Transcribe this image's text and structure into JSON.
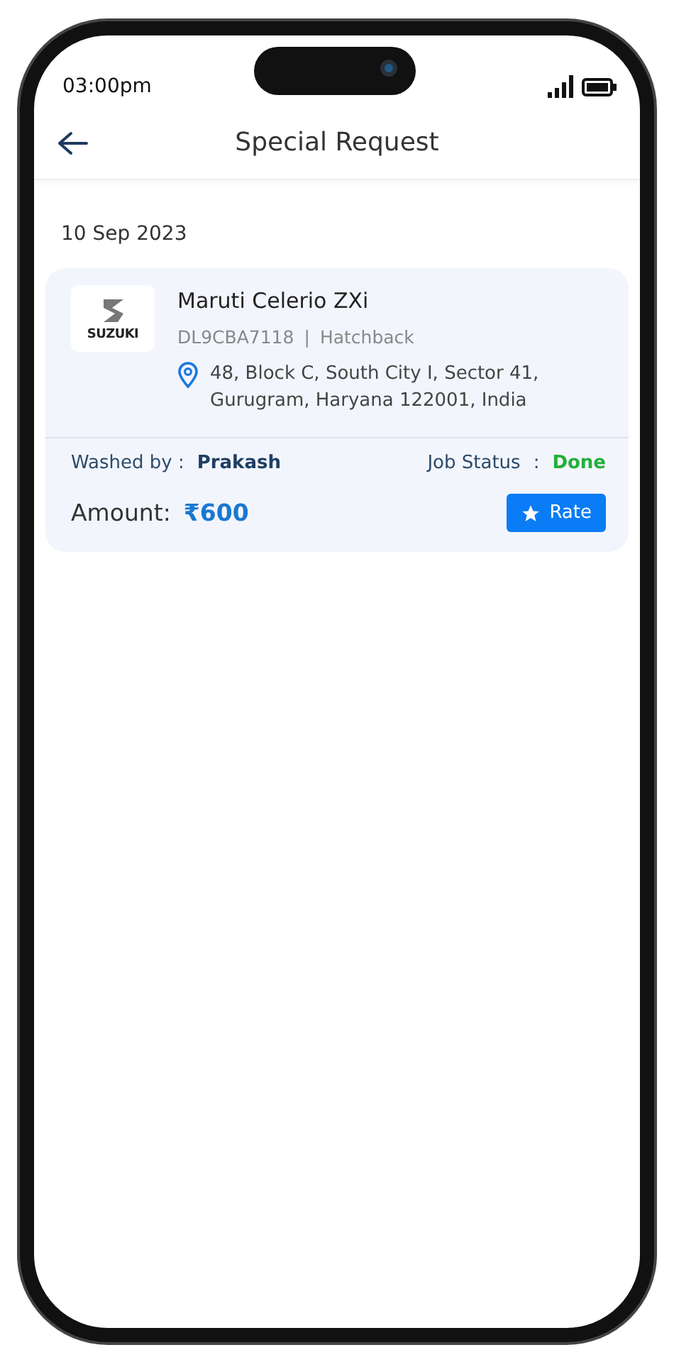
{
  "status_bar": {
    "time": "03:00pm"
  },
  "header": {
    "title": "Special Request"
  },
  "date": "10 Sep 2023",
  "request": {
    "logo_text": "SUZUKI",
    "car_name": "Maruti Celerio ZXi",
    "plate": "DL9CBA7118",
    "separator": "|",
    "body_type": "Hatchback",
    "address": "48, Block C, South City I, Sector 41, Gurugram, Haryana 122001, India",
    "washed_by_label": "Washed by :",
    "washer": "Prakash",
    "job_status_label": "Job Status",
    "job_status_colon": ":",
    "job_status": "Done",
    "job_completed": true,
    "amount_label": "Amount:",
    "amount": "₹600",
    "rate_button": "Rate"
  }
}
